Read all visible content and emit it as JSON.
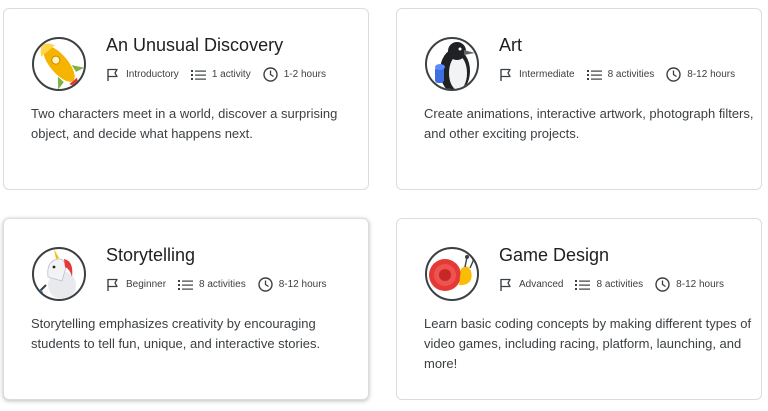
{
  "cards": [
    {
      "title": "An Unusual Discovery",
      "level": "Introductory",
      "activities": "1 activity",
      "duration": "1-2 hours",
      "description": "Two characters meet in a world, discover a surprising object, and decide what happens next.",
      "icon": "rocket-icon"
    },
    {
      "title": "Art",
      "level": "Intermediate",
      "activities": "8 activities",
      "duration": "8-12 hours",
      "description": "Create animations, interactive artwork, photograph filters, and other exciting projects.",
      "icon": "penguin-icon"
    },
    {
      "title": "Storytelling",
      "level": "Beginner",
      "activities": "8 activities",
      "duration": "8-12 hours",
      "description": "Storytelling emphasizes creativity by encouraging students to tell fun, unique, and interactive stories.",
      "icon": "unicorn-icon"
    },
    {
      "title": "Game Design",
      "level": "Advanced",
      "activities": "8 activities",
      "duration": "8-12 hours",
      "description": "Learn basic coding concepts by making different types of video games, including racing, platform, launching, and more!",
      "icon": "snail-icon"
    }
  ],
  "colors": {
    "border": "#dadce0",
    "text_primary": "#202124",
    "text_secondary": "#3c4043"
  }
}
